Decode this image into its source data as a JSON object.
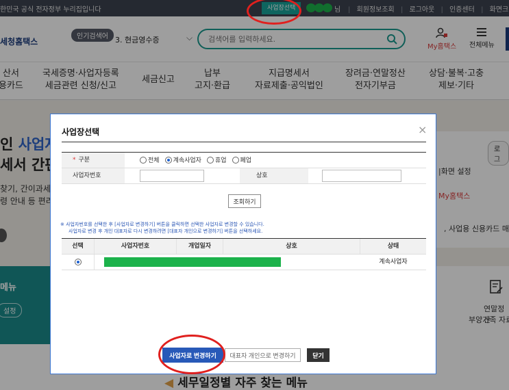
{
  "topbar": {
    "gov_notice": "한민국 공식 전자정부 누리집입니다",
    "biz_select_btn": "사업장선택",
    "nim": "님",
    "links": [
      "회원정보조회",
      "로그아웃",
      "인증센터",
      "화면크기"
    ]
  },
  "header": {
    "brand": "세청홈택스",
    "popular_label": "인기검색어",
    "popular_keyword": "3. 현금영수증",
    "search_placeholder": "검색어를 입력하세요.",
    "myhome": "My홈택스",
    "allmenu": "전체메뉴"
  },
  "gnb": [
    {
      "line1": "산서",
      "line2": "용카드"
    },
    {
      "line1": "국세증명·사업자등록",
      "line2": "세금관련 신청/신고"
    },
    {
      "line1": "세금신고",
      "line2": ""
    },
    {
      "line1": "납부",
      "line2": "고지·환급"
    },
    {
      "line1": "지급명세서",
      "line2": "자료제출·공익법인"
    },
    {
      "line1": "장려금·연말정산",
      "line2": "전자기부금"
    },
    {
      "line1": "상담·불복·고충",
      "line2": "제보·기타"
    }
  ],
  "hero": {
    "line1_pre": "인 ",
    "line1_accent": "사업자",
    "line2": "세서 간편",
    "para1": "찾기, 간이과세",
    "para2": "령 안내 등 편리"
  },
  "right_panel": {
    "login": "로그",
    "setting": "|화면 설정",
    "myhome": "My홈택스",
    "card": ", 사업용 신용카드 매"
  },
  "teal_box": {
    "title": "메뉴",
    "chip": "설정"
  },
  "right_lower": {
    "line1": "연말정산",
    "line2": "부양가족 자료"
  },
  "bottom_title": "세무일정별 자주 찾는 메뉴",
  "modal": {
    "title": "사업장선택",
    "close": "×",
    "form": {
      "type_label": "구분",
      "type_options": [
        {
          "label": "전체",
          "checked": false
        },
        {
          "label": "계속사업자",
          "checked": true
        },
        {
          "label": "휴업",
          "checked": false
        },
        {
          "label": "폐업",
          "checked": false
        }
      ],
      "bizno_label": "사업자번호",
      "bizno_value": "",
      "name_label": "상호",
      "name_value": ""
    },
    "search_button": "조회하기",
    "notice_line1": "※ 사업자번호를 선택한 후 [사업자로 변경하기] 버튼을 클릭하면 선택한 사업자로 변경할 수 있습니다.",
    "notice_line2": "사업자로 변경 후 개인 대표자로 다시 변경하려면 [대표자 개인으로 변경하기] 버튼을 선택하세요.",
    "table": {
      "headers": [
        "선택",
        "사업자번호",
        "개업일자",
        "상호",
        "상태"
      ],
      "rows": [
        {
          "selected": true,
          "status": "계속사업자"
        }
      ]
    },
    "buttons": {
      "change_to_biz": "사업자로 변경하기",
      "change_to_rep": "대표자 개인으로 변경하기",
      "close": "닫기"
    }
  },
  "colors": {
    "accent_teal": "#18a39a",
    "primary_blue": "#2859b8",
    "annotation_red": "#e0201e",
    "redaction_green": "#1cb24b"
  }
}
